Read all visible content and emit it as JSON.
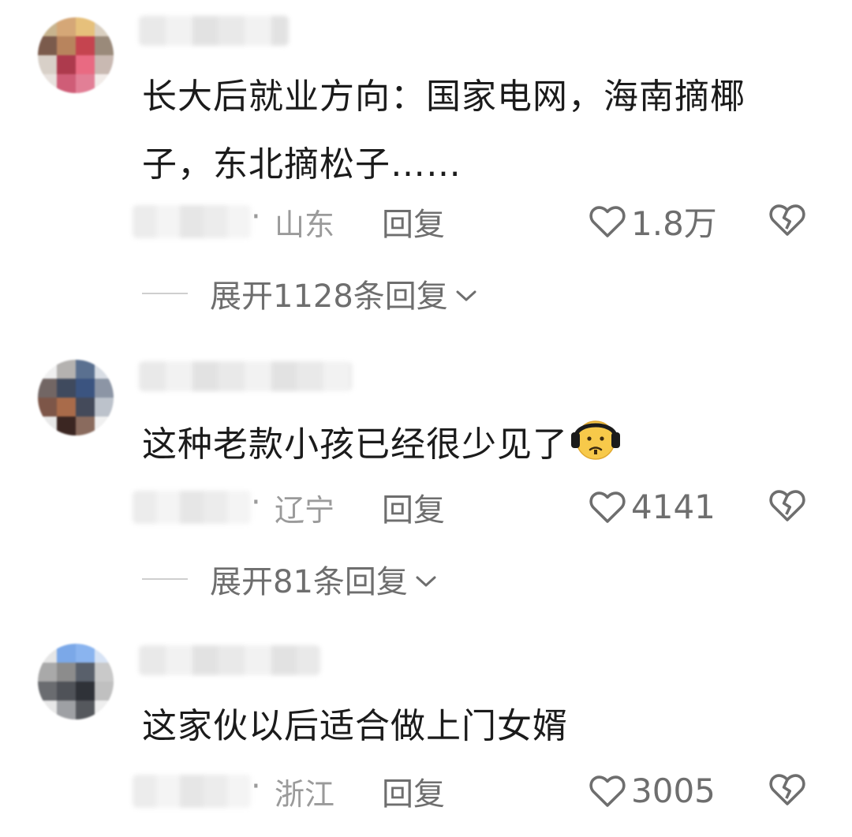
{
  "comments": [
    {
      "text": "长大后就业方向：国家电网，海南摘椰子，东北摘松子……",
      "location": "山东",
      "reply_label": "回复",
      "like_count": "1.8万",
      "expand_label": "展开1128条回复",
      "avatar_colors": [
        "#c8b48e",
        "#d5a777",
        "#e6c07b",
        "#d9cfc0",
        "#7b5b4c",
        "#b8845d",
        "#c5444f",
        "#9a8a7a",
        "#d8d0c8",
        "#ad3a4d",
        "#e96a82",
        "#c9b9b2",
        "#e8e2de",
        "#cf5d77",
        "#e27f96",
        "#f1ebe8"
      ]
    },
    {
      "text": "这种老款小孩已经很少见了",
      "location": "辽宁",
      "reply_label": "回复",
      "like_count": "4141",
      "expand_label": "展开81条回复",
      "avatar_colors": [
        "#f0f0f0",
        "#b4b2b0",
        "#5a7090",
        "#d8dde4",
        "#726664",
        "#3f4a5e",
        "#3b5480",
        "#8c95a5",
        "#7d5648",
        "#a96b4a",
        "#444a5a",
        "#bcc2cb",
        "#e8e8e8",
        "#3b2622",
        "#8a6b5e",
        "#f0f0f0"
      ]
    },
    {
      "text": "这家伙以后适合做上门女婿",
      "location": "浙江",
      "reply_label": "回复",
      "like_count": "3005",
      "avatar_colors": [
        "#e6e6e6",
        "#7ba8e8",
        "#8ab4ef",
        "#d7e3f5",
        "#a9a9a9",
        "#8c8c8c",
        "#59606b",
        "#c9c9c9",
        "#6a6c70",
        "#4f5258",
        "#2f3238",
        "#c0c0c0",
        "#e8e8e8",
        "#9ea0a4",
        "#55585d",
        "#efefef"
      ]
    }
  ],
  "icons": {
    "like": "heart-outline-icon",
    "dislike": "broken-heart-icon",
    "expand": "chevron-down-icon",
    "emoji": "headphones-frown-emoji"
  },
  "colors": {
    "text": "#1b1b1b",
    "meta": "#9a9a9a",
    "action": "#6e6e6e"
  }
}
